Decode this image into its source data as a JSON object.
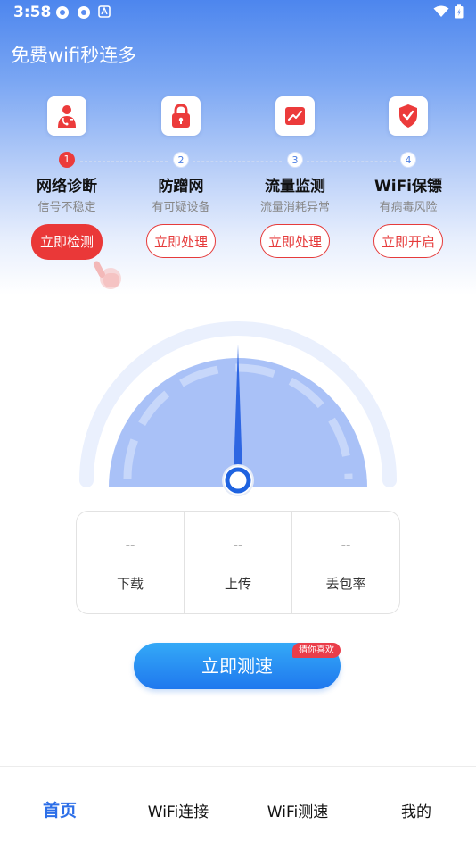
{
  "status": {
    "time": "3:58"
  },
  "app": {
    "title": "免费wifi秒连多"
  },
  "features": [
    {
      "step": "1",
      "name": "网络诊断",
      "desc": "信号不稳定",
      "action": "立即检测",
      "icon": "doctor-icon"
    },
    {
      "step": "2",
      "name": "防蹭网",
      "desc": "有可疑设备",
      "action": "立即处理",
      "icon": "lock-icon"
    },
    {
      "step": "3",
      "name": "流量监测",
      "desc": "流量消耗异常",
      "action": "立即处理",
      "icon": "chart-icon"
    },
    {
      "step": "4",
      "name": "WiFi保镖",
      "desc": "有病毒风险",
      "action": "立即开启",
      "icon": "shield-icon"
    }
  ],
  "stats": [
    {
      "value": "--",
      "label": "下载"
    },
    {
      "value": "--",
      "label": "上传"
    },
    {
      "value": "--",
      "label": "丢包率"
    }
  ],
  "speed_test": {
    "label": "立即测速",
    "badge": "猜你喜欢"
  },
  "nav": [
    {
      "label": "首页",
      "active": true
    },
    {
      "label": "WiFi连接",
      "active": false
    },
    {
      "label": "WiFi测速",
      "active": false
    },
    {
      "label": "我的",
      "active": false
    }
  ],
  "colors": {
    "accent_red": "#ea3838",
    "accent_blue": "#2d6fe8",
    "gauge_fill": "#a9c1f7"
  }
}
